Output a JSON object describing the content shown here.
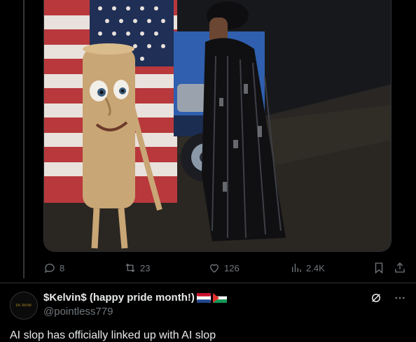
{
  "tweet_actions": {
    "replies": "8",
    "reposts": "23",
    "likes": "126",
    "views": "2.4K"
  },
  "reply_post": {
    "display_name": "$Kelvin$ (happy pride month!)",
    "flags": [
      "flag-netherlands-icon",
      "flag-palestine-icon"
    ],
    "handle": "@pointless779",
    "text": "AI slop has officially linked up with AI slop",
    "avatar_text": "IN ROW"
  },
  "icons": {
    "reply": "speech-bubble-icon",
    "repost": "repost-arrows-icon",
    "like": "heart-icon",
    "views": "bar-chart-icon",
    "bookmark": "bookmark-icon",
    "share": "share-icon",
    "grok": "grok-icon",
    "more": "more-dots-icon"
  },
  "colors": {
    "background": "#000000",
    "muted_text": "#71767b",
    "primary_text": "#e7e9ea",
    "divider": "#2f3336"
  }
}
